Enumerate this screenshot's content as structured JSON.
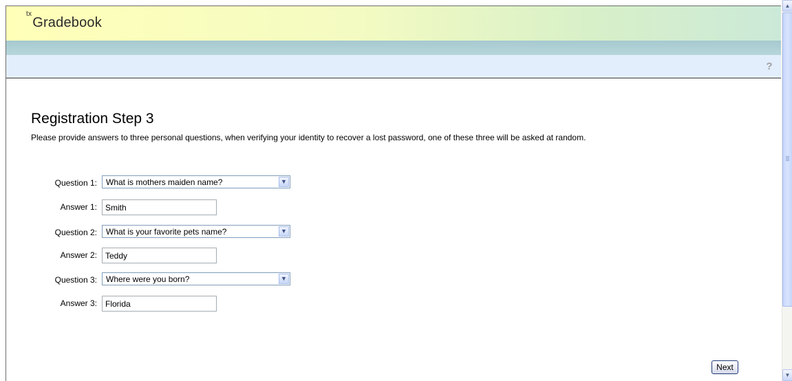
{
  "app": {
    "logo_prefix": "tx",
    "logo_text": "Gradebook",
    "help_icon_glyph": "?"
  },
  "page": {
    "title": "Registration Step 3",
    "instructions": "Please provide answers to three personal questions, when verifying your identity to recover a lost password, one of these three will be asked at random."
  },
  "form": {
    "questions": [
      {
        "label": "Question 1:",
        "selected": "What is mothers maiden name?",
        "answer_label": "Answer 1:",
        "answer": "Smith"
      },
      {
        "label": "Question 2:",
        "selected": "What is your favorite pets name?",
        "answer_label": "Answer 2:",
        "answer": "Teddy"
      },
      {
        "label": "Question 3:",
        "selected": "Where were you born?",
        "answer_label": "Answer 3:",
        "answer": "Florida"
      }
    ],
    "next_label": "Next"
  },
  "icons": {
    "help": "help-icon",
    "dropdown": "chevron-down-icon",
    "scroll_up": "chevron-up-icon",
    "scroll_down": "chevron-down-icon"
  },
  "colors": {
    "banner_start": "#ffffb8",
    "banner_end": "#cbe9d8",
    "nav_strip": "#b0d0d6",
    "toolbar": "#e3eefc"
  }
}
